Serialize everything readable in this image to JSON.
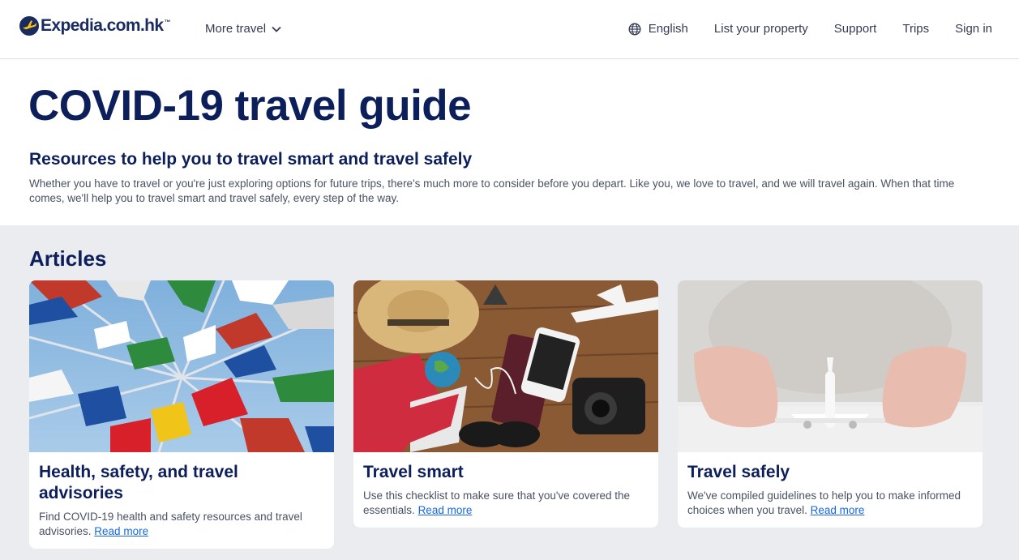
{
  "header": {
    "logo_text": "Expedia.com.hk",
    "logo_tm": "™",
    "more_travel": "More travel",
    "language": "English",
    "list_property": "List your property",
    "support": "Support",
    "trips": "Trips",
    "sign_in": "Sign in"
  },
  "hero": {
    "title": "COVID-19 travel guide",
    "subtitle": "Resources to help you to travel smart and travel safely",
    "description": "Whether you have to travel or you're just exploring options for future trips, there's much more to consider before you depart. Like you, we love to travel, and we will travel again. When that time comes, we'll help you to travel smart and travel safely, every step of the way."
  },
  "articles": {
    "title": "Articles",
    "cards": [
      {
        "title": "Health, safety, and travel advisories",
        "text": "Find COVID-19 health and safety resources and travel advisories.",
        "link": "Read more",
        "image": "flags-sky-image"
      },
      {
        "title": "Travel smart",
        "text": "Use this checklist to make sure that you've covered the essentials.",
        "link": "Read more",
        "image": "travel-items-image"
      },
      {
        "title": "Travel safely",
        "text": "We've compiled guidelines to help you to make informed choices when you travel.",
        "link": "Read more",
        "image": "hands-airplane-image"
      }
    ]
  },
  "colors": {
    "brand_navy": "#0c1f5a",
    "link_blue": "#1668e3",
    "section_bg": "#ebecf0",
    "logo_yellow": "#fcc20e"
  }
}
